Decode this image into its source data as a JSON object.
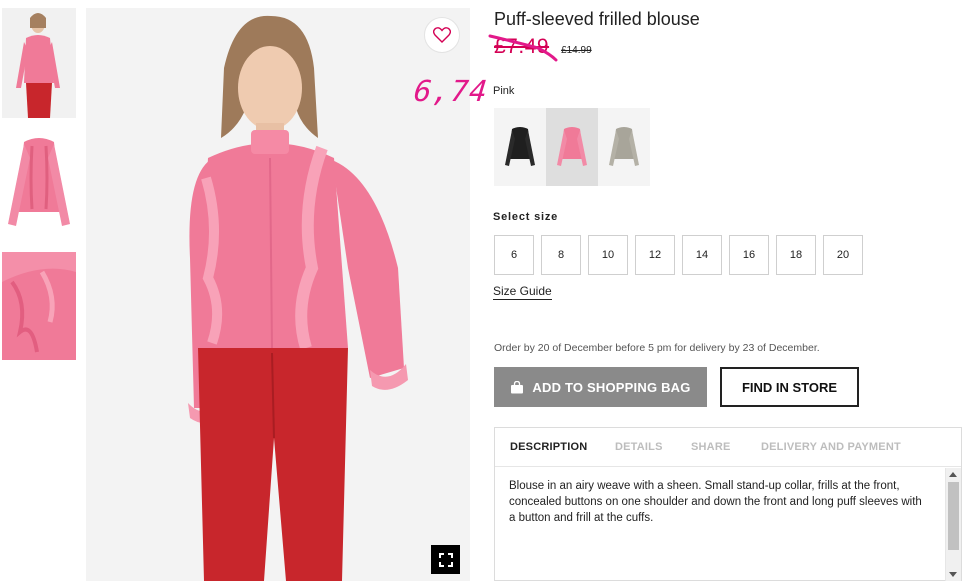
{
  "product": {
    "title": "Puff-sleeved frilled blouse",
    "sale_price": "£7.49",
    "original_price": "£14.99",
    "handwritten_note": "6,74"
  },
  "colors": {
    "selected_name": "Pink",
    "swatches": [
      "black",
      "pink",
      "grey"
    ]
  },
  "sizes": {
    "label": "Select size",
    "options": [
      "6",
      "8",
      "10",
      "12",
      "14",
      "16",
      "18",
      "20"
    ],
    "guide_label": "Size Guide"
  },
  "delivery": {
    "note": "Order by 20 of December before 5 pm for delivery by 23 of December."
  },
  "actions": {
    "add_to_bag": "ADD TO SHOPPING BAG",
    "find_in_store": "FIND IN STORE"
  },
  "tabs": {
    "items": [
      "DESCRIPTION",
      "DETAILS",
      "SHARE",
      "DELIVERY AND PAYMENT"
    ],
    "active": "DESCRIPTION"
  },
  "description": {
    "text": "Blouse in an airy weave with a sheen. Small stand-up collar, frills at the front, concealed buttons on one shoulder and down the front and long puff sleeves with a button and frill at the cuffs."
  },
  "colors_hex": {
    "sale": "#d40054",
    "pink_garment": "#f07a98",
    "trousers": "#c8262c",
    "bag_button": "#8a8a8a"
  },
  "icons": [
    "heart-icon",
    "fullscreen-icon",
    "shopping-bag-icon"
  ]
}
